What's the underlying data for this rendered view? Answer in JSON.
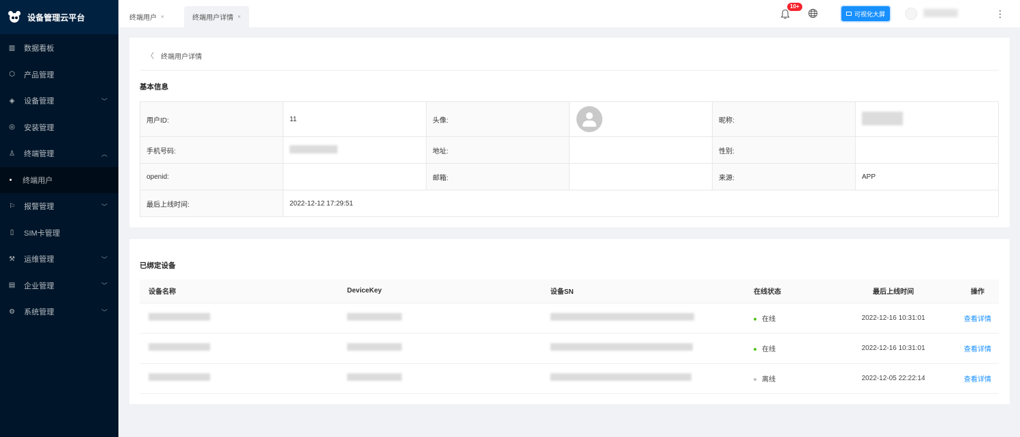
{
  "app": {
    "title": "设备管理云平台"
  },
  "sidebar": {
    "items": [
      {
        "label": "数据看板",
        "icon": "bar-chart-icon",
        "glyph": "▥"
      },
      {
        "label": "产品管理",
        "icon": "cube-icon",
        "glyph": "⬡"
      },
      {
        "label": "设备管理",
        "icon": "layers-icon",
        "glyph": "◈",
        "chevron": "﹀"
      },
      {
        "label": "安装管理",
        "icon": "check-circle-icon",
        "glyph": "◎"
      },
      {
        "label": "终端管理",
        "icon": "user-icon",
        "glyph": "♙",
        "chevron": "︿"
      },
      {
        "label": "终端用户",
        "sub": true
      },
      {
        "label": "报警管理",
        "icon": "alarm-icon",
        "glyph": "⚐",
        "chevron": "﹀"
      },
      {
        "label": "SIM卡管理",
        "icon": "sim-card-icon",
        "glyph": "▯"
      },
      {
        "label": "运维管理",
        "icon": "tool-icon",
        "glyph": "⚒",
        "chevron": "﹀"
      },
      {
        "label": "企业管理",
        "icon": "building-icon",
        "glyph": "▤",
        "chevron": "﹀"
      },
      {
        "label": "系统管理",
        "icon": "settings-icon",
        "glyph": "⚙",
        "chevron": "﹀"
      }
    ]
  },
  "header": {
    "tabs": [
      {
        "label": "终端用户",
        "close": "×"
      },
      {
        "label": "终端用户详情",
        "close": "×"
      }
    ],
    "notification_badge": "10+",
    "viz_button": "可视化大屏",
    "more": "⋮"
  },
  "detail": {
    "back_arrow": "〈",
    "breadcrumb": "终端用户详情",
    "basic_title": "基本信息",
    "labels": {
      "user_id": "用户ID:",
      "avatar": "头像:",
      "nickname": "昵称:",
      "phone": "手机号码:",
      "address": "地址:",
      "gender": "性别:",
      "openid": "openid:",
      "email": "邮箱:",
      "source": "来源:",
      "last_online": "最后上线时间:"
    },
    "values": {
      "user_id": "11",
      "address": "",
      "gender": "",
      "openid": "",
      "email": "",
      "source": "APP",
      "last_online": "2022-12-12 17:29:51"
    }
  },
  "devices": {
    "title": "已绑定设备",
    "columns": [
      "设备名称",
      "DeviceKey",
      "设备SN",
      "在线状态",
      "最后上线时间",
      "操作"
    ],
    "rows": [
      {
        "status": "在线",
        "status_color": "#52c41a",
        "last_online": "2022-12-16 10:31:01",
        "action": "查看详情"
      },
      {
        "status": "在线",
        "status_color": "#52c41a",
        "last_online": "2022-12-16 10:31:01",
        "action": "查看详情"
      },
      {
        "status": "离线",
        "status_color": "#bfbfbf",
        "last_online": "2022-12-05 22:22:14",
        "action": "查看详情"
      }
    ]
  },
  "colors": {
    "sidebar": "#001529",
    "primary": "#1890ff",
    "badge": "#f5222d"
  }
}
